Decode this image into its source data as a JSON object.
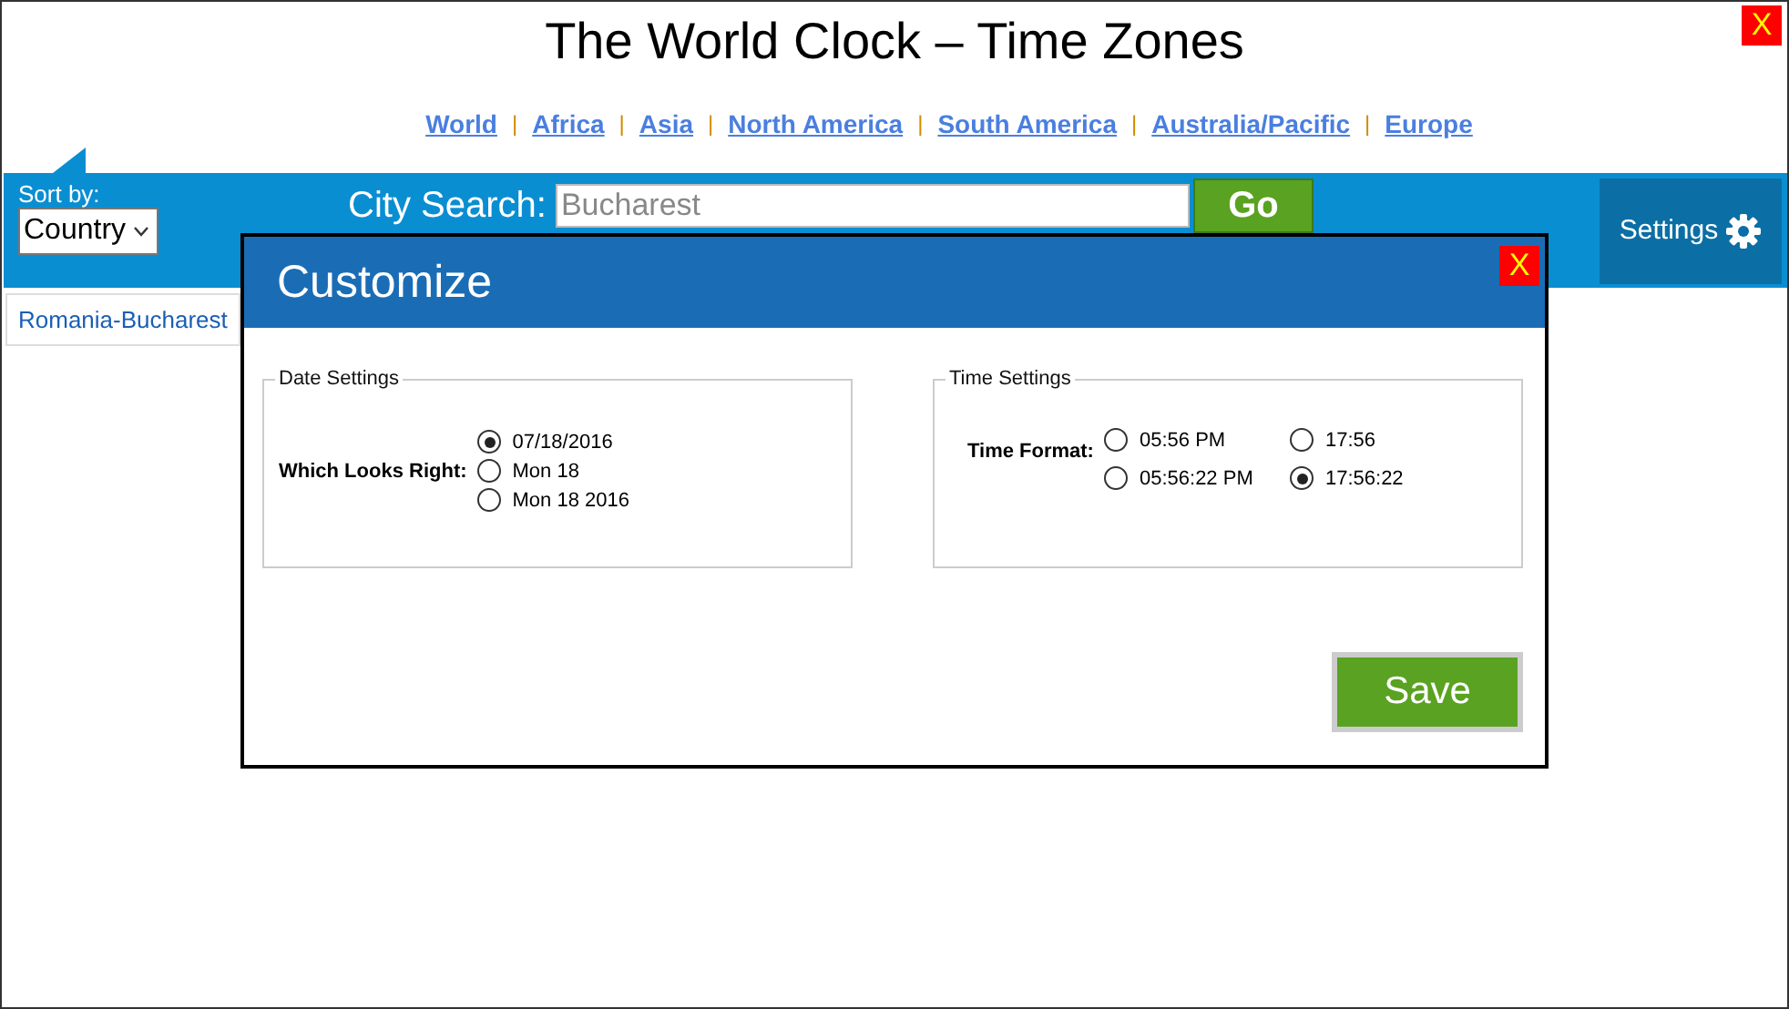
{
  "title": "The World Clock – Time Zones",
  "nav": [
    {
      "label": "World",
      "sep": "|"
    },
    {
      "label": "Africa",
      "sep": "|"
    },
    {
      "label": "Asia",
      "sep": "|"
    },
    {
      "label": "North America",
      "sep": "|"
    },
    {
      "label": "South America",
      "sep": "|"
    },
    {
      "label": "Australia/Pacific",
      "sep": "|"
    },
    {
      "label": "Europe"
    }
  ],
  "close": "X",
  "toolbar": {
    "sort_label": "Sort by:",
    "sort_value": "Country",
    "search_label": "City Search:",
    "search_value": "Bucharest",
    "go": "Go",
    "settings": "Settings"
  },
  "cities": [
    "Romania-Bucharest"
  ],
  "dialog": {
    "title": "Customize",
    "close": "X",
    "date": {
      "legend": "Date Settings",
      "label": "Which Looks Right:",
      "options": [
        {
          "label": "07/18/2016",
          "selected": true
        },
        {
          "label": "Mon 18",
          "selected": false
        },
        {
          "label": "Mon 18 2016",
          "selected": false
        }
      ]
    },
    "time": {
      "legend": "Time Settings",
      "label": "Time Format:",
      "options": [
        {
          "label": "05:56 PM",
          "selected": false
        },
        {
          "label": "17:56",
          "selected": false
        },
        {
          "label": "05:56:22 PM",
          "selected": false
        },
        {
          "label": "17:56:22",
          "selected": true
        }
      ]
    },
    "save": "Save"
  }
}
